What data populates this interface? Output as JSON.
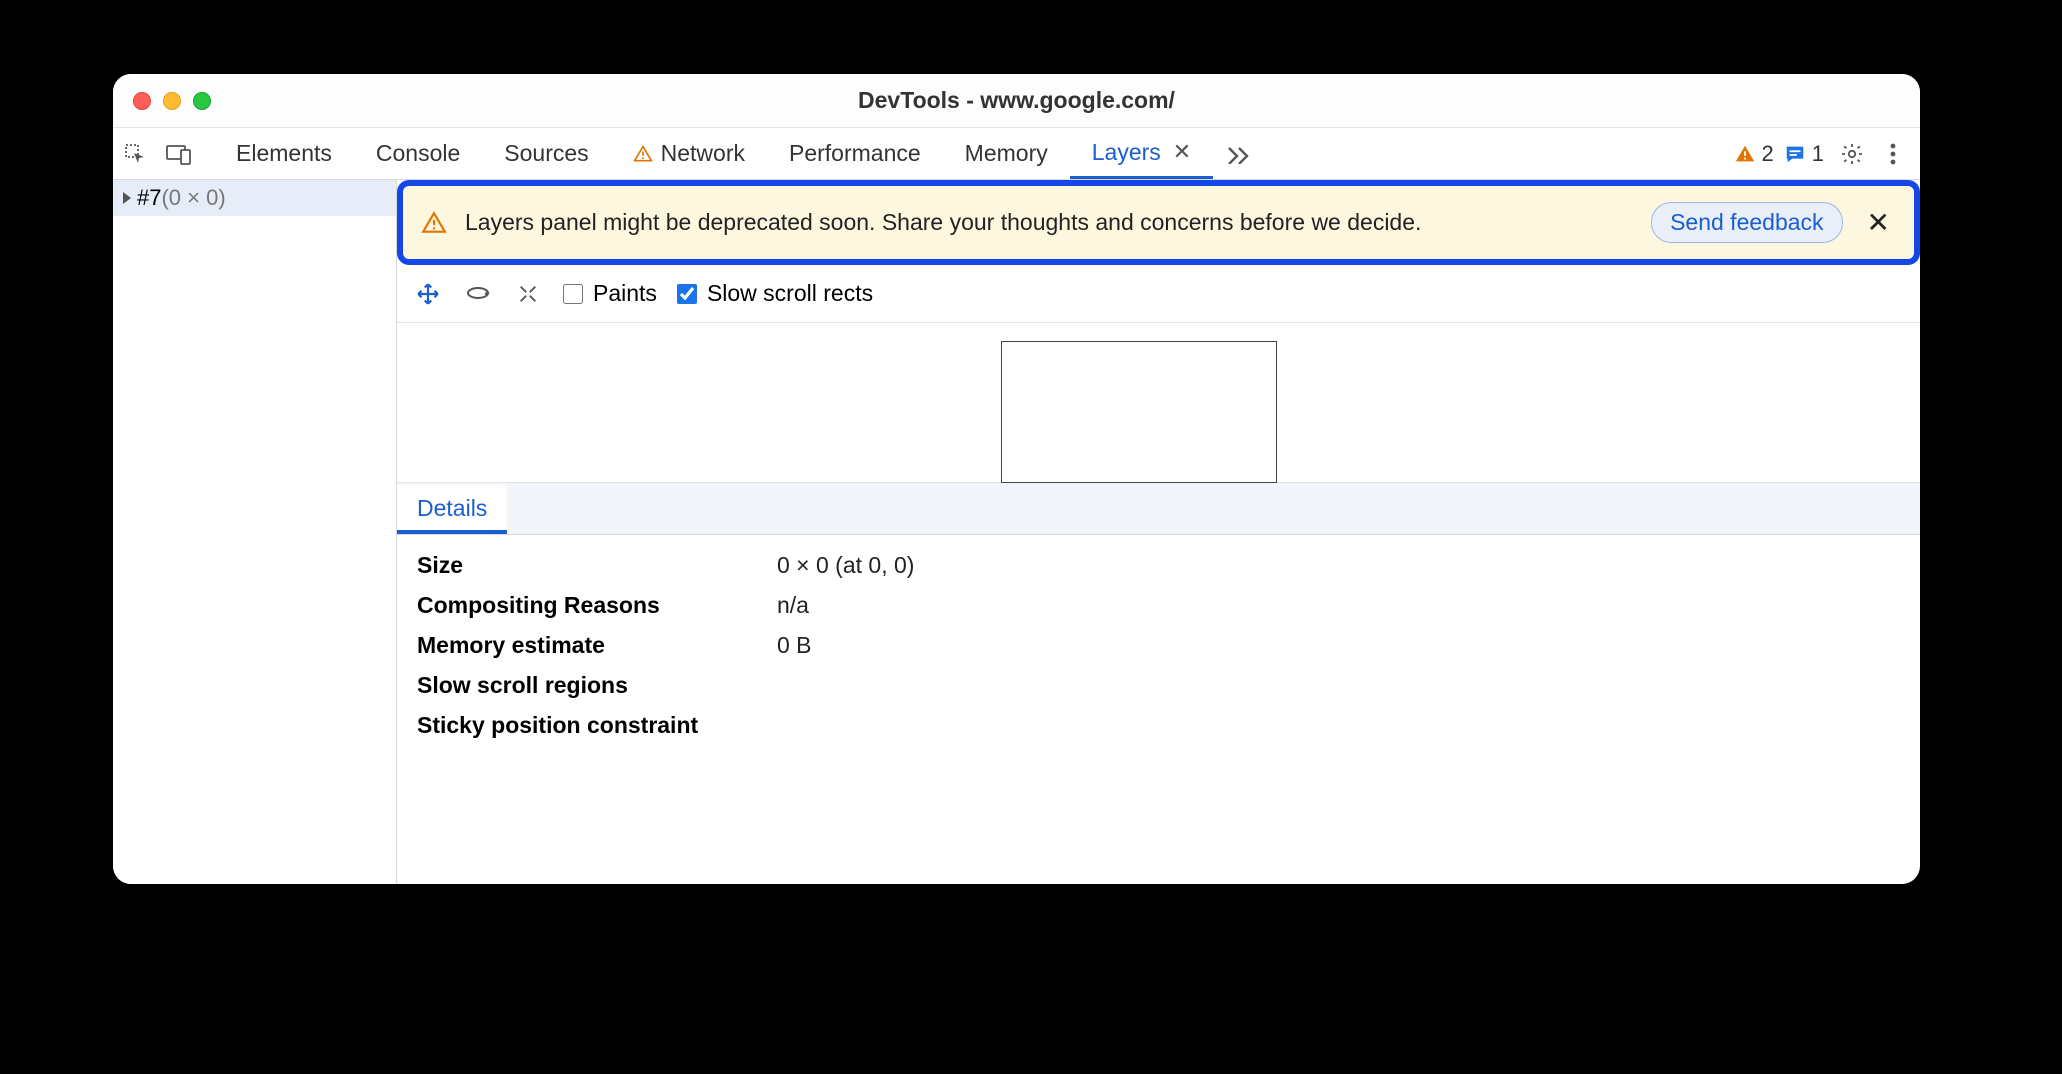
{
  "window": {
    "title": "DevTools - www.google.com/"
  },
  "tabs": {
    "items": [
      "Elements",
      "Console",
      "Sources",
      "Network",
      "Performance",
      "Memory",
      "Layers"
    ],
    "active": "Layers",
    "network_has_warning": true
  },
  "toolbar_right": {
    "warning_count": "2",
    "message_count": "1"
  },
  "tree": {
    "row0_name": "#7",
    "row0_dims": "(0 × 0)"
  },
  "infobar": {
    "text": "Layers panel might be deprecated soon. Share your thoughts and concerns before we decide.",
    "button": "Send feedback"
  },
  "layers_toolbar": {
    "paints_label": "Paints",
    "paints_checked": false,
    "slow_label": "Slow scroll rects",
    "slow_checked": true
  },
  "details_tab": {
    "label": "Details"
  },
  "details": {
    "rows": [
      {
        "k": "Size",
        "v": "0 × 0 (at 0, 0)"
      },
      {
        "k": "Compositing Reasons",
        "v": "n/a"
      },
      {
        "k": "Memory estimate",
        "v": "0 B"
      },
      {
        "k": "Slow scroll regions",
        "v": ""
      },
      {
        "k": "Sticky position constraint",
        "v": ""
      }
    ]
  }
}
